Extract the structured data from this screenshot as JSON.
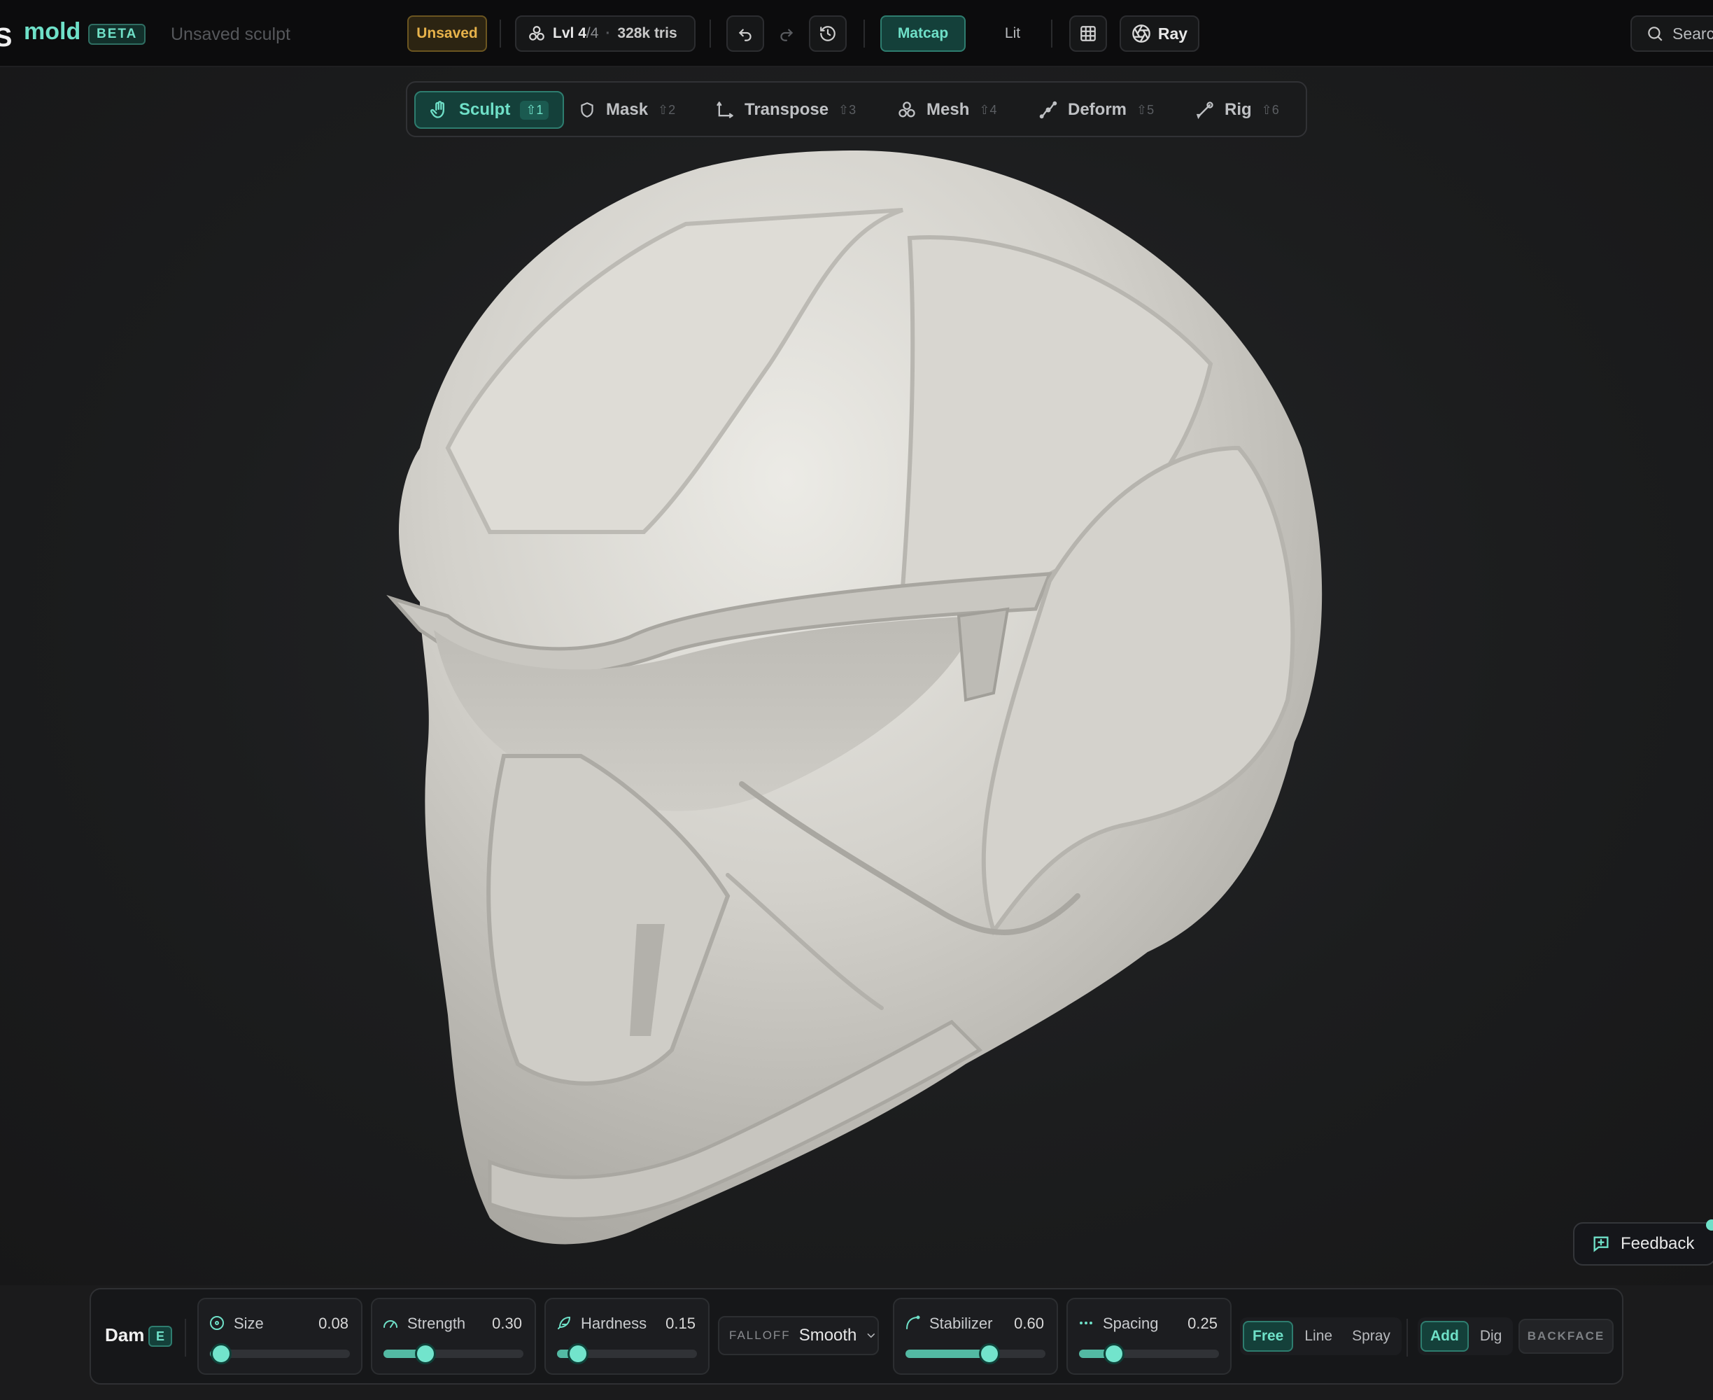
{
  "app": {
    "logo_glyph": "S",
    "name": "mold",
    "badge": "BETA",
    "document_title": "Unsaved sculpt"
  },
  "status": {
    "saved_state": "Unsaved"
  },
  "mesh_info": {
    "level_label": "Lvl",
    "level_current": "4",
    "level_total": "/4",
    "tris": "328k tris"
  },
  "history": {
    "undo_icon": "undo-icon",
    "redo_icon": "redo-icon",
    "history_icon": "history-icon"
  },
  "shading": {
    "matcap_label": "Matcap",
    "lit_label": "Lit"
  },
  "view": {
    "grid_icon": "grid-icon",
    "ray_label": "Ray"
  },
  "search": {
    "label": "Search"
  },
  "modes": [
    {
      "label": "Sculpt",
      "shortcut": "⇧1",
      "icon": "hand-icon",
      "active": true
    },
    {
      "label": "Mask",
      "shortcut": "⇧2",
      "icon": "shield-icon",
      "active": false
    },
    {
      "label": "Transpose",
      "shortcut": "⇧3",
      "icon": "transpose-icon",
      "active": false
    },
    {
      "label": "Mesh",
      "shortcut": "⇧4",
      "icon": "mesh-icon",
      "active": false
    },
    {
      "label": "Deform",
      "shortcut": "⇧5",
      "icon": "deform-icon",
      "active": false
    },
    {
      "label": "Rig",
      "shortcut": "⇧6",
      "icon": "bone-icon",
      "active": false
    }
  ],
  "feedback": {
    "label": "Feedback"
  },
  "brush": {
    "name": "Dam",
    "shortcut": "E",
    "size": {
      "label": "Size",
      "value": "0.08",
      "fraction": 0.08
    },
    "strength": {
      "label": "Strength",
      "value": "0.30",
      "fraction": 0.3
    },
    "hardness": {
      "label": "Hardness",
      "value": "0.15",
      "fraction": 0.15
    },
    "falloff": {
      "label": "FALLOFF",
      "value": "Smooth"
    },
    "stabilizer": {
      "label": "Stabilizer",
      "value": "0.60",
      "fraction": 0.6
    },
    "spacing": {
      "label": "Spacing",
      "value": "0.25",
      "fraction": 0.25
    },
    "stroke_modes": [
      "Free",
      "Line",
      "Spray"
    ],
    "stroke_mode_selected": "Free",
    "direction_modes": [
      "Add",
      "Dig"
    ],
    "direction_selected": "Add",
    "backface_label": "BACKFACE"
  },
  "colors": {
    "accent": "#6fe0c8",
    "accent_bg": "#14403a",
    "warning": "#e7b24a",
    "background": "#1b1b1c"
  }
}
